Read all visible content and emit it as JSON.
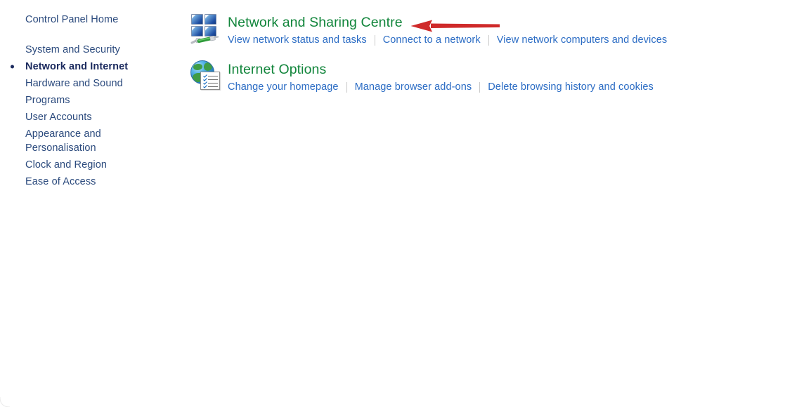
{
  "window": {
    "background_color": "#ffffff"
  },
  "colors": {
    "sidebar_link": "#2b4a7d",
    "sidebar_current": "#1b2a5e",
    "category_title": "#11853b",
    "category_link": "#2b6cc4",
    "separator": "#c9c9c9",
    "annotation_arrow": "#cf2a2a"
  },
  "sidebar": {
    "home_label": "Control Panel Home",
    "items": [
      {
        "label": "System and Security",
        "current": false
      },
      {
        "label": "Network and Internet",
        "current": true
      },
      {
        "label": "Hardware and Sound",
        "current": false
      },
      {
        "label": "Programs",
        "current": false
      },
      {
        "label": "User Accounts",
        "current": false
      },
      {
        "label": "Appearance and Personalisation",
        "current": false
      },
      {
        "label": "Clock and Region",
        "current": false
      },
      {
        "label": "Ease of Access",
        "current": false
      }
    ]
  },
  "main": {
    "categories": [
      {
        "icon": "network-sharing-centre-icon",
        "title": "Network and Sharing Centre",
        "links": [
          "View network status and tasks",
          "Connect to a network",
          "View network computers and devices"
        ]
      },
      {
        "icon": "internet-options-icon",
        "title": "Internet Options",
        "links": [
          "Change your homepage",
          "Manage browser add-ons",
          "Delete browsing history and cookies"
        ]
      }
    ]
  },
  "annotation": {
    "type": "arrow",
    "direction": "left",
    "color": "#cf2a2a",
    "points_to": "Network and Sharing Centre"
  }
}
